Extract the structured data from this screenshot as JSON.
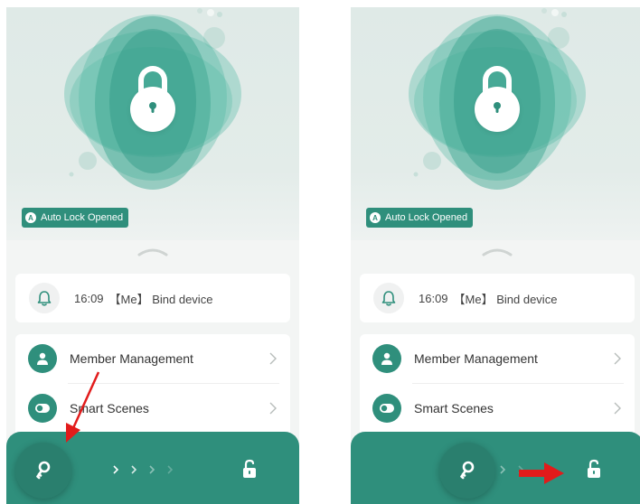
{
  "colors": {
    "primary": "#2f8f7c",
    "primary_dark": "#2a7f6e",
    "blob": "#4fb8a2",
    "hero_bg": "#e0ebe8",
    "annotation_red": "#e21b1b"
  },
  "screens": [
    {
      "status_badge": {
        "icon": "A",
        "label": "Auto Lock Opened"
      },
      "log": {
        "icon": "bell-icon",
        "time": "16:09",
        "text": "【Me】 Bind device"
      },
      "menu": [
        {
          "icon": "person-icon",
          "label": "Member Management"
        },
        {
          "icon": "toggle-icon",
          "label": "Smart Scenes"
        }
      ],
      "unlock_slider": {
        "key_icon": "key-icon",
        "target_icon": "unlock-icon",
        "progress": 0
      }
    },
    {
      "status_badge": {
        "icon": "A",
        "label": "Auto Lock Opened"
      },
      "log": {
        "icon": "bell-icon",
        "time": "16:09",
        "text": "【Me】 Bind device"
      },
      "menu": [
        {
          "icon": "person-icon",
          "label": "Member Management"
        },
        {
          "icon": "toggle-icon",
          "label": "Smart Scenes"
        }
      ],
      "unlock_slider": {
        "key_icon": "key-icon",
        "target_icon": "unlock-icon",
        "progress": 0.25
      }
    }
  ]
}
